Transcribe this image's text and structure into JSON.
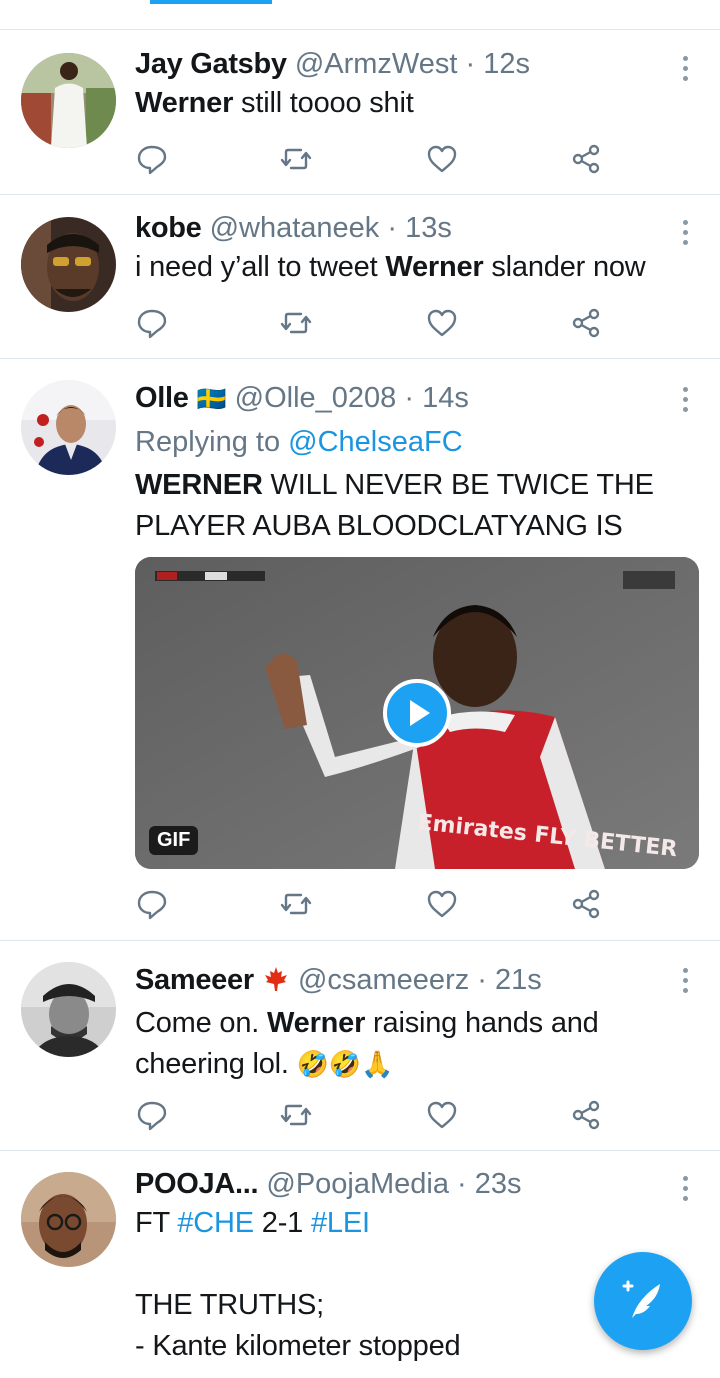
{
  "colors": {
    "accent": "#1da1f2",
    "link": "#1b95e0",
    "secondary": "#657786"
  },
  "tweets": [
    {
      "name": "Jay Gatsby",
      "handle": "@ArmzWest",
      "time": "12s",
      "text_parts": [
        {
          "t": "Werner",
          "b": true
        },
        {
          "t": " still toooo shit",
          "b": false
        }
      ]
    },
    {
      "name": "kobe",
      "handle": "@whataneek",
      "time": "13s",
      "text_parts": [
        {
          "t": "i need y’all to tweet ",
          "b": false
        },
        {
          "t": "Werner",
          "b": true
        },
        {
          "t": " slander now",
          "b": false
        }
      ]
    },
    {
      "name": "Olle",
      "flag": "🇸🇪",
      "handle": "@Olle_0208",
      "time": "14s",
      "reply_prefix": "Replying to",
      "reply_to": "@ChelseaFC",
      "line1_bold": "WERNER",
      "line1_rest": " WILL NEVER BE TWICE THE",
      "line2": "PLAYER AUBA BLOODCLATYANG IS",
      "media_badge": "GIF",
      "media_text": "Emirates FLY BETTER"
    },
    {
      "name": "Sameeer",
      "handle": "@csameeerz",
      "time": "21s",
      "line1_a": "Come on. ",
      "line1_bold": "Werner",
      "line1_b": " raising hands and",
      "line2": "cheering lol. ",
      "emojis": "🤣🤣🙏"
    },
    {
      "name": "POOJA...",
      "handle": "@PoojaMedia",
      "time": "23s",
      "line1_a": "FT ",
      "tag1": "#CHE",
      "line1_b": " 2-1 ",
      "tag2": "#LEI",
      "line3": "THE TRUTHS;",
      "line4": "- Kante kilometer stopped"
    }
  ],
  "separator": "·"
}
